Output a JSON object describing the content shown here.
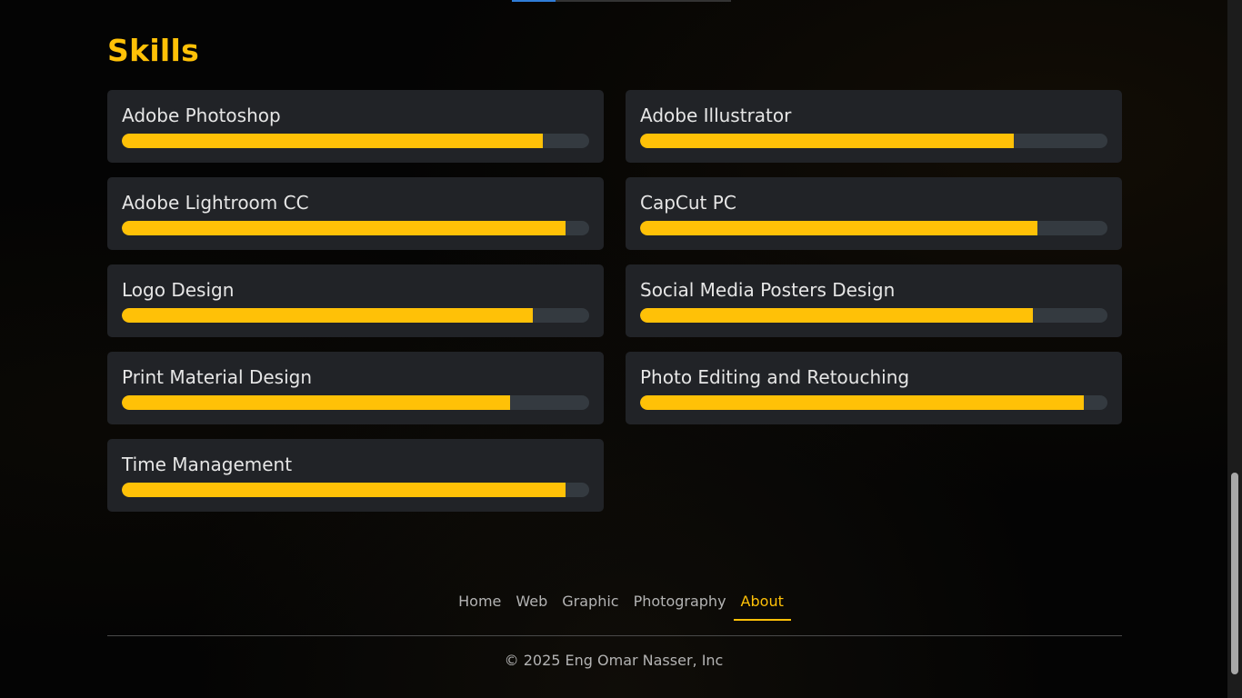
{
  "skills_section": {
    "title": "Skills",
    "items": [
      {
        "name": "Adobe Photoshop",
        "level": 0.9
      },
      {
        "name": "Adobe Illustrator",
        "level": 0.8
      },
      {
        "name": "Adobe Lightroom CC",
        "level": 0.95
      },
      {
        "name": "CapCut PC",
        "level": 0.85
      },
      {
        "name": "Logo Design",
        "level": 0.88
      },
      {
        "name": "Social Media Posters Design",
        "level": 0.84
      },
      {
        "name": "Print Material Design",
        "level": 0.83
      },
      {
        "name": "Photo Editing and Retouching",
        "level": 0.95
      },
      {
        "name": "Time Management",
        "level": 0.95
      }
    ]
  },
  "colors": {
    "accent": "#ffc107",
    "card_bg": "#212327",
    "track_bg": "#343a40"
  },
  "footer": {
    "nav": [
      {
        "label": "Home",
        "active": false
      },
      {
        "label": "Web",
        "active": false
      },
      {
        "label": "Graphic",
        "active": false
      },
      {
        "label": "Photography",
        "active": false
      },
      {
        "label": "About",
        "active": true
      }
    ],
    "copyright": "© 2025 Eng Omar Nasser, Inc"
  }
}
